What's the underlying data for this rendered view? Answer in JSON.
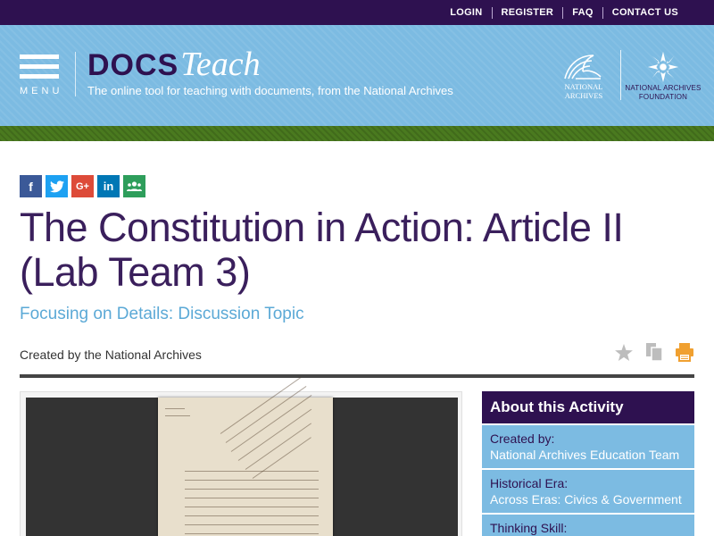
{
  "topnav": {
    "login": "LOGIN",
    "register": "REGISTER",
    "faq": "FAQ",
    "contact": "CONTACT US"
  },
  "header": {
    "menu_label": "MENU",
    "logo_docs": "DOCS",
    "logo_teach": "Teach",
    "tagline": "The online tool for teaching with documents, from the National Archives",
    "na_logo_text": "NATIONAL ARCHIVES",
    "naf_logo_text": "NATIONAL ARCHIVES FOUNDATION"
  },
  "share": {
    "facebook_glyph": "f",
    "google_glyph": "G+",
    "linkedin_glyph": "in"
  },
  "page": {
    "title": "The Constitution in Action: Article II (Lab Team 3)",
    "subtitle": "Focusing on Details: Discussion Topic",
    "created_by": "Created by the National Archives"
  },
  "sidebar": {
    "heading": "About this Activity",
    "items": [
      {
        "label": "Created by:",
        "value": "National Archives Education Team"
      },
      {
        "label": "Historical Era:",
        "value": "Across Eras: Civics & Government"
      },
      {
        "label": "Thinking Skill:",
        "value": ""
      }
    ]
  },
  "colors": {
    "top_bar": "#2e1150",
    "header_blue": "#7cbbe2",
    "green_bar": "#4a7a1f",
    "title_purple": "#3a1f5c",
    "subtitle_blue": "#5ba9d6",
    "print_orange": "#f0a030"
  },
  "icons": [
    "facebook-icon",
    "twitter-icon",
    "google-plus-icon",
    "linkedin-icon",
    "classroom-icon",
    "star-icon",
    "copy-icon",
    "print-icon",
    "national-archives-eagle-icon",
    "foundation-star-icon"
  ]
}
